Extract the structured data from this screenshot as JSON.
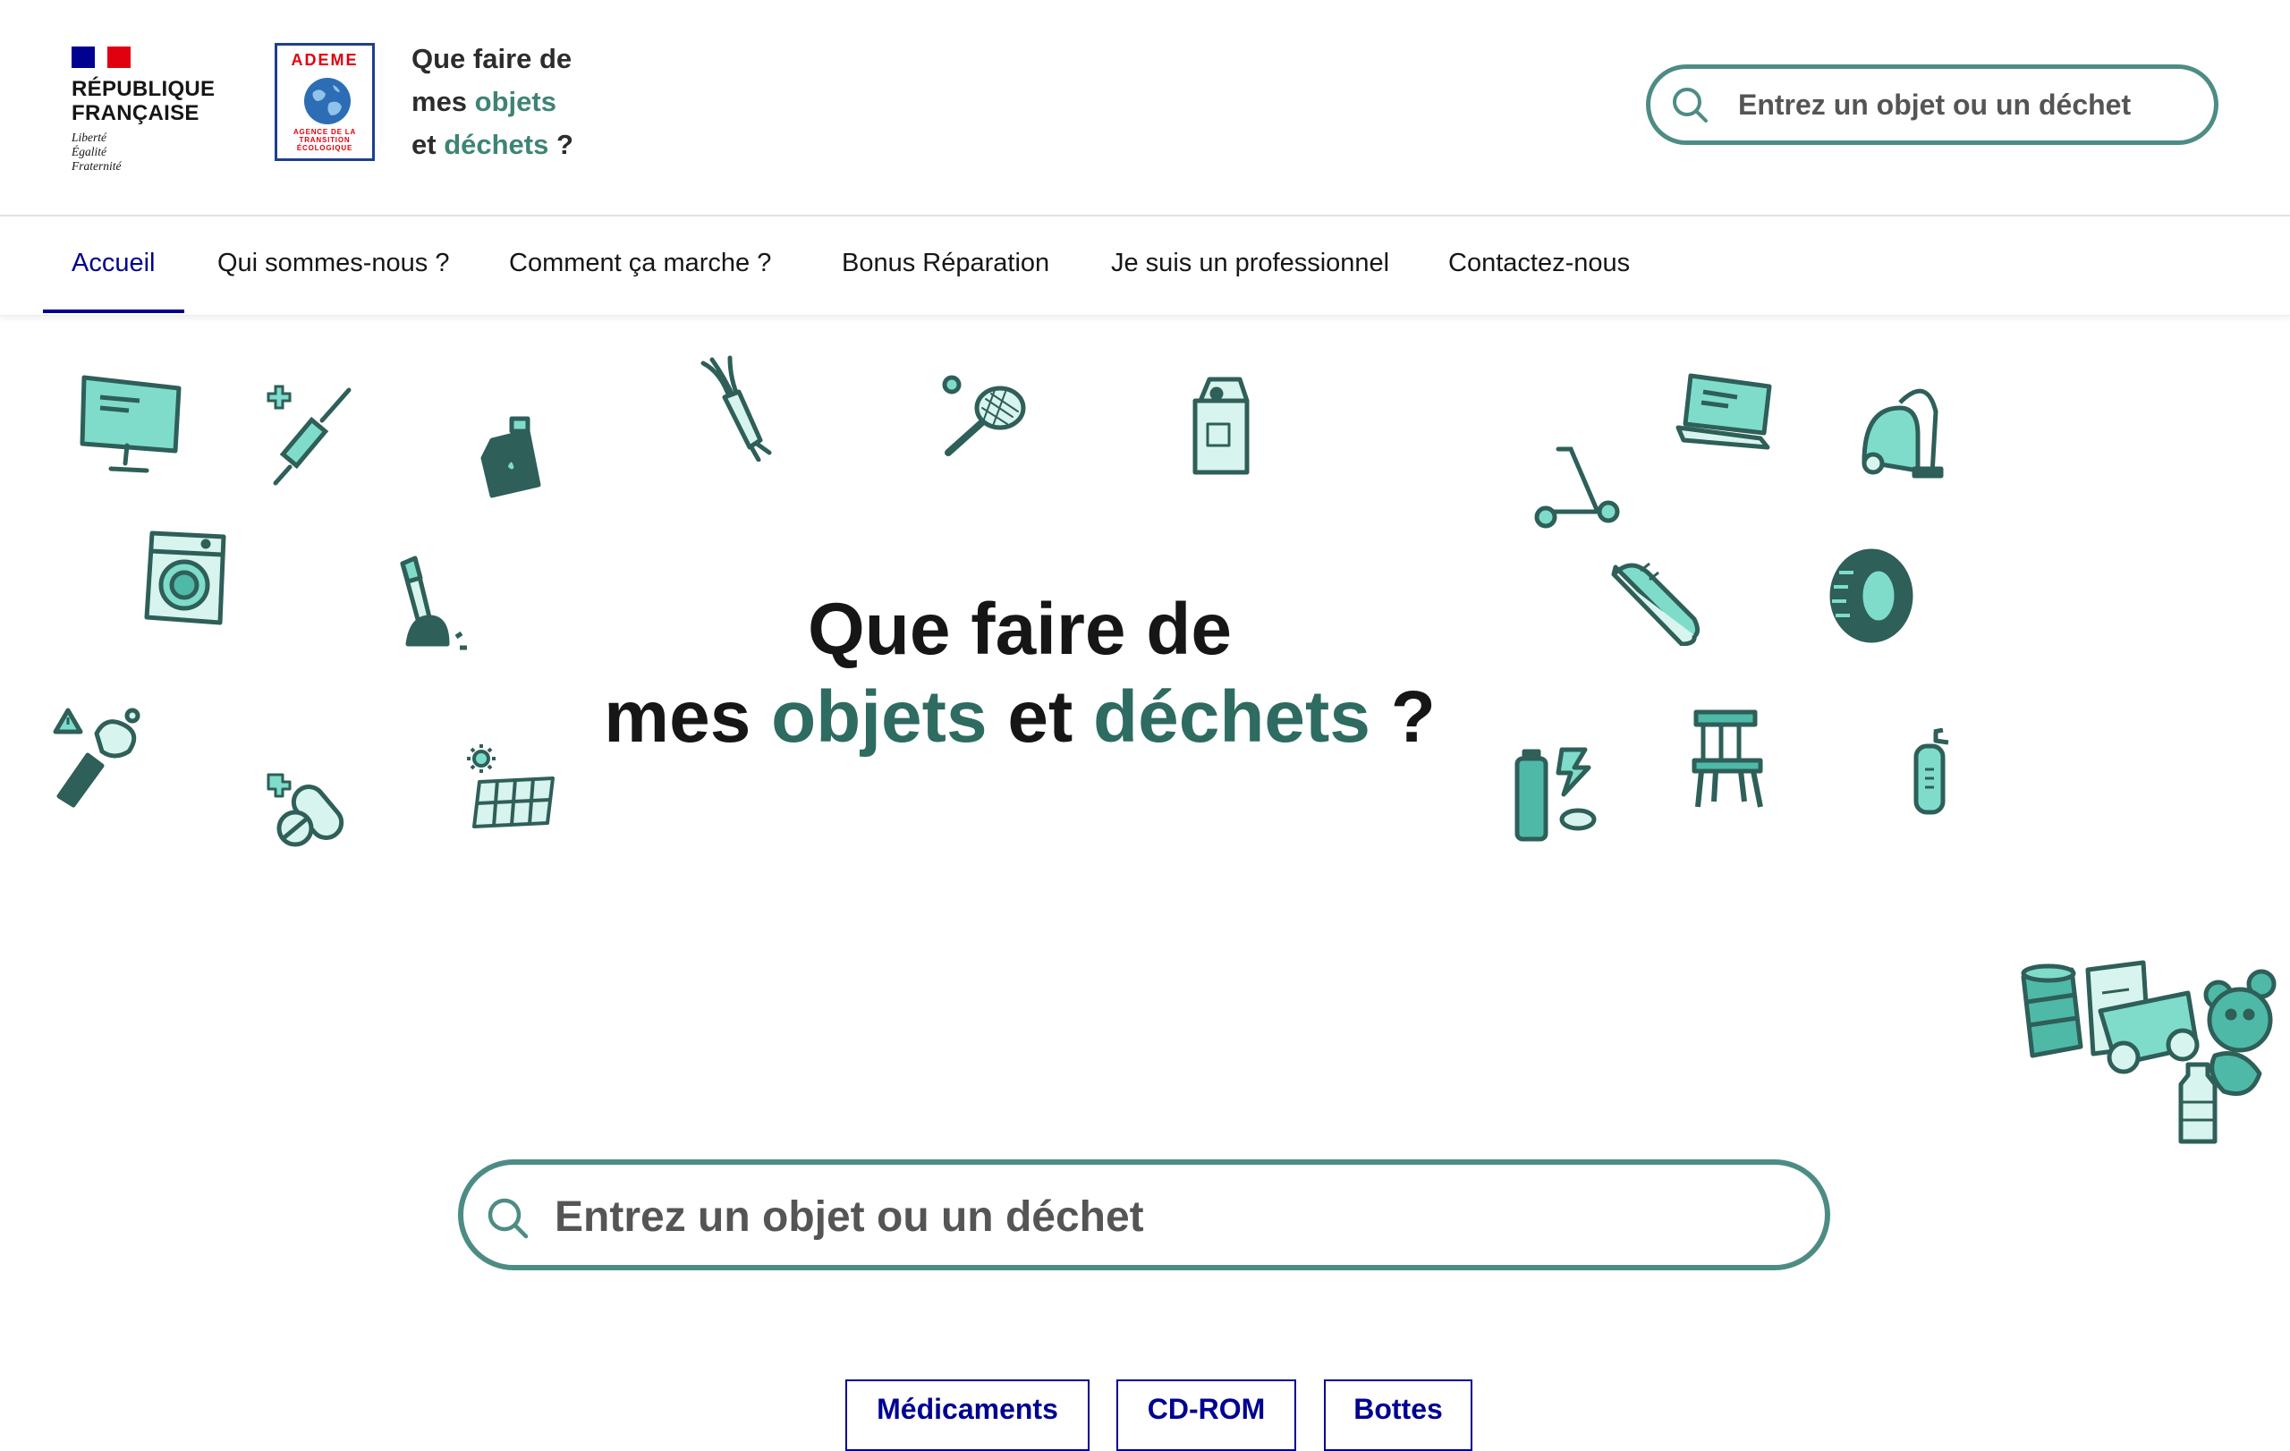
{
  "header": {
    "republic_lines": [
      "RÉPUBLIQUE",
      "FRANÇAISE"
    ],
    "motto_lines": [
      "Liberté",
      "Égalité",
      "Fraternité"
    ],
    "ademe_logo": {
      "title": "ADEME",
      "subtitle_lines": [
        "AGENCE DE LA",
        "TRANSITION",
        "ÉCOLOGIQUE"
      ]
    },
    "site_title": {
      "line1": "Que faire de",
      "line2_a": "mes ",
      "line2_b": "objets",
      "line3_a": "et ",
      "line3_b": "déchets",
      "line3_c": " ?"
    },
    "search": {
      "placeholder": "Entrez un objet ou un déchet",
      "icon": "search-icon"
    }
  },
  "nav": {
    "items": [
      {
        "label": "Accueil",
        "active": true
      },
      {
        "label": "Qui sommes-nous ?",
        "active": false
      },
      {
        "label": "Comment ça marche ?",
        "active": false
      },
      {
        "label": "Bonus Réparation",
        "active": false
      },
      {
        "label": "Je suis un professionnel",
        "active": false
      },
      {
        "label": "Contactez-nous",
        "active": false
      }
    ]
  },
  "hero": {
    "title_line1": "Que faire de",
    "title_line2_a": "mes ",
    "title_line2_b": "objets",
    "title_line2_c": " et ",
    "title_line2_d": "déchets",
    "title_line2_e": " ?",
    "illustrations": [
      "monitor-icon",
      "syringe-icon",
      "oil-can-icon",
      "leek-icon",
      "badminton-racket-icon",
      "milk-carton-icon",
      "laptop-icon",
      "vacuum-cleaner-icon",
      "washing-machine-icon",
      "cigarette-icon",
      "scooter-icon",
      "sneaker-icon",
      "tire-icon",
      "hazardous-spray-icon",
      "pills-icon",
      "solar-panel-icon",
      "battery-icon",
      "chair-icon",
      "fire-extinguisher-icon",
      "waste-pile-icon"
    ]
  },
  "main_search": {
    "placeholder": "Entrez un objet ou un déchet",
    "icon": "search-icon"
  },
  "suggestions": [
    "Médicaments",
    "CD-ROM",
    "Bottes"
  ],
  "colors": {
    "brand_blue": "#000091",
    "accent_green": "#2e6b61",
    "search_border": "#4d8c84",
    "illustration_fill": "#7fdccb",
    "illustration_stroke": "#2e5f58"
  }
}
